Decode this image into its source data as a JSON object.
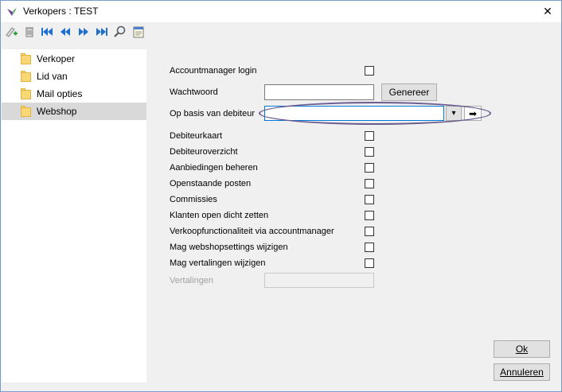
{
  "window": {
    "title": "Verkopers : TEST",
    "close_glyph": "✕"
  },
  "toolbar": {
    "buttons": [
      {
        "name": "add-record-icon"
      },
      {
        "name": "delete-icon"
      },
      {
        "name": "first-record-icon"
      },
      {
        "name": "previous-record-icon"
      },
      {
        "name": "next-record-icon"
      },
      {
        "name": "last-record-icon"
      },
      {
        "name": "search-icon"
      },
      {
        "name": "notes-icon"
      }
    ]
  },
  "sidebar": {
    "items": [
      {
        "label": "Verkoper",
        "selected": false
      },
      {
        "label": "Lid van",
        "selected": false
      },
      {
        "label": "Mail opties",
        "selected": false
      },
      {
        "label": "Webshop",
        "selected": true
      }
    ]
  },
  "form": {
    "accountmanager_login": {
      "label": "Accountmanager login",
      "checked": false
    },
    "wachtwoord": {
      "label": "Wachtwoord",
      "value": "",
      "button": "Genereer"
    },
    "op_basis_van_debiteur": {
      "label": "Op basis van debiteur",
      "value": "",
      "dropdown_glyph": "▾",
      "go_glyph": "➡"
    },
    "permissions": [
      {
        "label": "Debiteurkaart",
        "checked": false
      },
      {
        "label": "Debiteuroverzicht",
        "checked": false
      },
      {
        "label": "Aanbiedingen beheren",
        "checked": false
      },
      {
        "label": "Openstaande posten",
        "checked": false
      },
      {
        "label": "Commissies",
        "checked": false
      },
      {
        "label": "Klanten open dicht zetten",
        "checked": false
      },
      {
        "label": "Verkoopfunctionaliteit via accountmanager",
        "checked": false
      },
      {
        "label": "Mag webshopsettings wijzigen",
        "checked": false
      },
      {
        "label": "Mag vertalingen wijzigen",
        "checked": false
      }
    ],
    "vertalingen": {
      "label": "Vertalingen",
      "value": "",
      "disabled": true
    }
  },
  "buttons": {
    "ok": {
      "label": "Ok"
    },
    "cancel": {
      "label": "Annuleren"
    }
  }
}
